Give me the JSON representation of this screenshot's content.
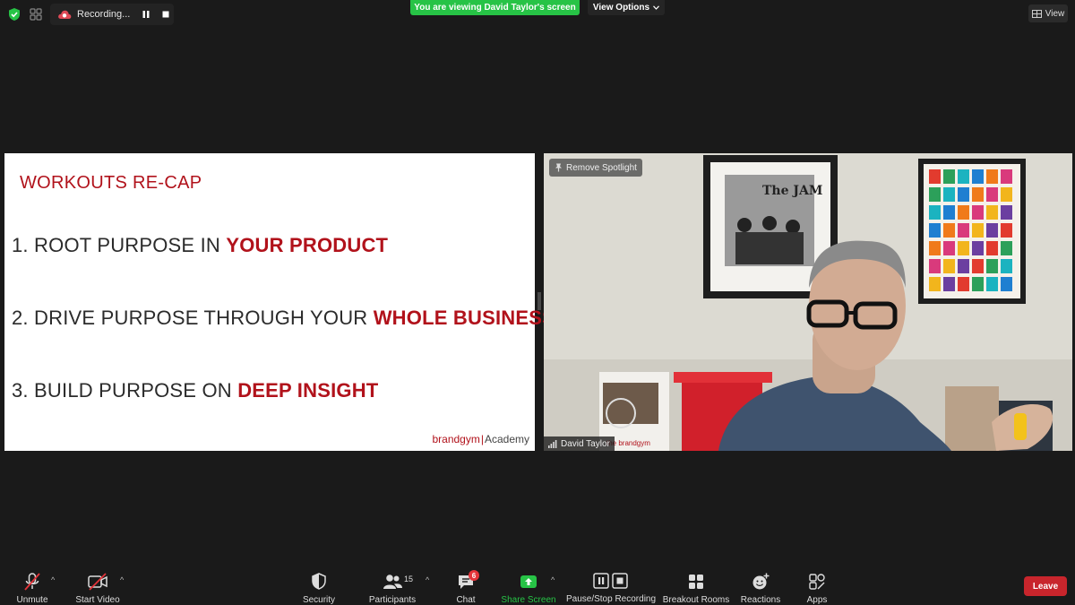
{
  "topbar": {
    "recording_label": "Recording...",
    "viewing_banner": "You are viewing David Taylor's screen",
    "view_options_label": "View Options",
    "view_label": "View"
  },
  "slide": {
    "title": "WORKOUTS RE-CAP",
    "points": [
      {
        "prefix": "1. ROOT PURPOSE IN ",
        "emphasis": "YOUR PRODUCT"
      },
      {
        "prefix": "2. DRIVE PURPOSE THROUGH YOUR ",
        "emphasis": "WHOLE BUSINESS"
      },
      {
        "prefix": "3. BUILD PURPOSE ON ",
        "emphasis": "DEEP INSIGHT"
      }
    ],
    "logo_brand": "brandgym",
    "logo_academy": "Academy"
  },
  "video": {
    "remove_spotlight_label": "Remove Spotlight",
    "participant_name": "David Taylor",
    "poster_text": "The JAM",
    "book_text": "the brandgym"
  },
  "toolbar": {
    "unmute_label": "Unmute",
    "start_video_label": "Start Video",
    "security_label": "Security",
    "participants_label": "Participants",
    "participants_count": "15",
    "chat_label": "Chat",
    "chat_badge": "6",
    "share_screen_label": "Share Screen",
    "pause_stop_recording_label": "Pause/Stop Recording",
    "breakout_rooms_label": "Breakout Rooms",
    "reactions_label": "Reactions",
    "apps_label": "Apps",
    "leave_label": "Leave"
  },
  "colors": {
    "accent_red": "#b1121b",
    "green": "#27c346",
    "leave_red": "#c8252c",
    "background": "#1a1a1a"
  }
}
